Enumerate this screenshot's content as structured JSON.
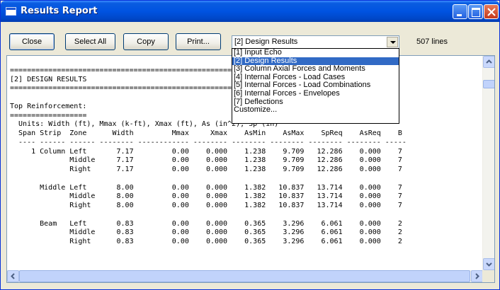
{
  "window": {
    "title": "Results Report"
  },
  "toolbar": {
    "close_label": "Close",
    "select_all_label": "Select All",
    "copy_label": "Copy",
    "print_label": "Print..."
  },
  "report_select": {
    "selected": "[2] Design Results",
    "options": [
      "[1] Input Echo",
      "[2] Design Results",
      "[3] Column Axial Forces and Moments",
      "[4] Internal Forces - Load Cases",
      "[5] Internal Forces - Load Combinations",
      "[6] Internal Forces - Envelopes",
      "[7] Deflections",
      "Customize..."
    ],
    "highlighted_index": 1
  },
  "line_count": "507 lines",
  "report_text": "\n================================================================================\n[2] DESIGN RESULTS\n================================================================================\n\nTop Reinforcement:\n==================\n  Units: Width (ft), Mmax (k-ft), Xmax (ft), As (in^2), Sp (in)\n  Span Strip  Zone      Width         Mmax     Xmax    AsMin    AsMax    SpReq    AsReq    B\n  ---- ------ ------ -------- ------------ -------- -------- -------- -------- -------- -----\n     1 Column Left       7.17         0.00    0.000    1.238    9.709   12.286    0.000    7\n              Middle     7.17         0.00    0.000    1.238    9.709   12.286    0.000    7\n              Right      7.17         0.00    0.000    1.238    9.709   12.286    0.000    7\n\n       Middle Left       8.00         0.00    0.000    1.382   10.837   13.714    0.000    7\n              Middle     8.00         0.00    0.000    1.382   10.837   13.714    0.000    7\n              Right      8.00         0.00    0.000    1.382   10.837   13.714    0.000    7\n\n       Beam   Left       0.83         0.00    0.000    0.365    3.296    6.061    0.000    2\n              Middle     0.83         0.00    0.000    0.365    3.296    6.061    0.000    2\n              Right      0.83         0.00    0.000    0.365    3.296    6.061    0.000    2"
}
